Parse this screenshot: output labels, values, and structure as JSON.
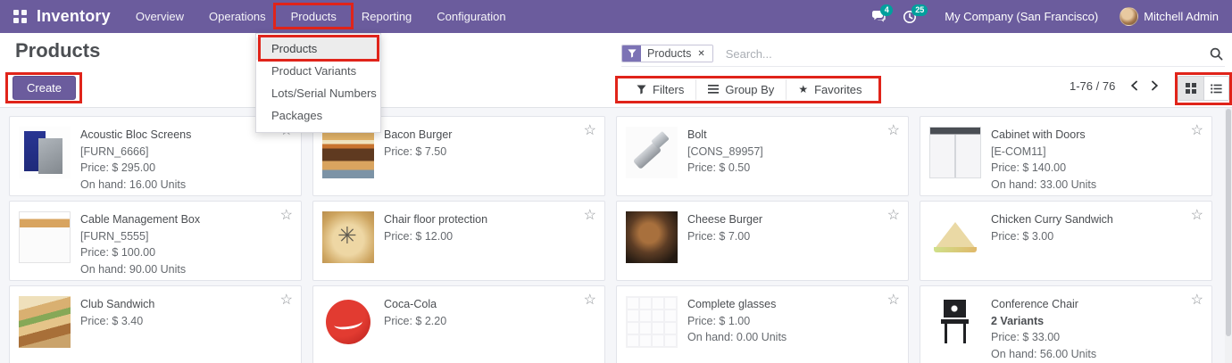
{
  "nav": {
    "app_name": "Inventory",
    "menu": [
      "Overview",
      "Operations",
      "Products",
      "Reporting",
      "Configuration"
    ],
    "messages_badge": "4",
    "activities_badge": "25",
    "company": "My Company (San Francisco)",
    "user": "Mitchell Admin"
  },
  "products_dropdown": {
    "items": [
      "Products",
      "Product Variants",
      "Lots/Serial Numbers",
      "Packages"
    ]
  },
  "control_panel": {
    "title": "Products",
    "create_label": "Create",
    "search": {
      "facet": "Products",
      "placeholder": "Search..."
    },
    "filters_label": "Filters",
    "group_by_label": "Group By",
    "favorites_label": "Favorites",
    "pager": "1-76 / 76"
  },
  "icons": {
    "favorite_outline": "☆",
    "favorites_star": "★",
    "facet_remove": "✕"
  },
  "colors": {
    "navbar": "#6b5c9d",
    "badge_teal": "#00a09d",
    "annotation_red": "#e0241a"
  },
  "products": [
    {
      "name": "Acoustic Bloc Screens",
      "ref": "[FURN_6666]",
      "price": "Price: $ 295.00",
      "on_hand": "On hand: 16.00 Units"
    },
    {
      "name": "Bacon Burger",
      "price": "Price: $ 7.50"
    },
    {
      "name": "Bolt",
      "ref": "[CONS_89957]",
      "price": "Price: $ 0.50"
    },
    {
      "name": "Cabinet with Doors",
      "ref": "[E-COM11]",
      "price": "Price: $ 140.00",
      "on_hand": "On hand: 33.00 Units"
    },
    {
      "name": "Cable Management Box",
      "ref": "[FURN_5555]",
      "price": "Price: $ 100.00",
      "on_hand": "On hand: 90.00 Units"
    },
    {
      "name": "Chair floor protection",
      "price": "Price: $ 12.00"
    },
    {
      "name": "Cheese Burger",
      "price": "Price: $ 7.00"
    },
    {
      "name": "Chicken Curry Sandwich",
      "price": "Price: $ 3.00"
    },
    {
      "name": "Club Sandwich",
      "price": "Price: $ 3.40"
    },
    {
      "name": "Coca-Cola",
      "price": "Price: $ 2.20"
    },
    {
      "name": "Complete glasses",
      "price": "Price: $ 1.00",
      "on_hand": "On hand: 0.00 Units"
    },
    {
      "name": "Conference Chair",
      "variants": "2 Variants",
      "price": "Price: $ 33.00",
      "on_hand": "On hand: 56.00 Units"
    }
  ]
}
